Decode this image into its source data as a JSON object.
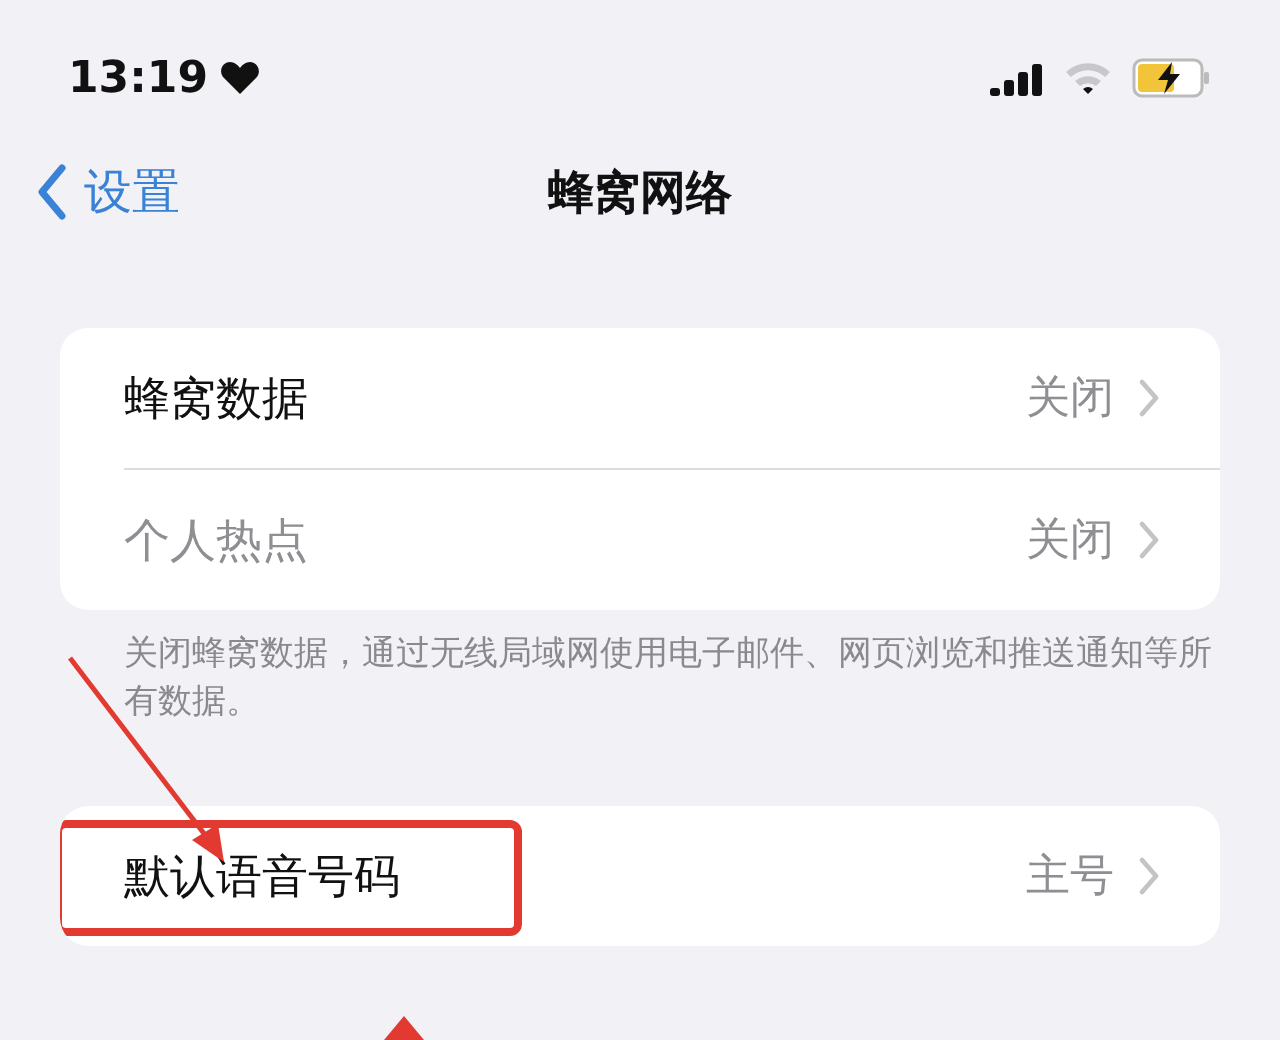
{
  "status_bar": {
    "time": "13:19"
  },
  "nav": {
    "back": "设置",
    "title": "蜂窝网络"
  },
  "groups": [
    {
      "rows": [
        {
          "label": "蜂窝数据",
          "value": "关闭",
          "disabled": false,
          "highlighted": false
        },
        {
          "label": "个人热点",
          "value": "关闭",
          "disabled": true,
          "highlighted": false
        }
      ],
      "footer": "关闭蜂窝数据，通过无线局域网使用电子邮件、网页浏览和推送通知等所有数据。"
    },
    {
      "rows": [
        {
          "label": "默认语音号码",
          "value": "主号",
          "disabled": false,
          "highlighted": true
        }
      ]
    }
  ]
}
